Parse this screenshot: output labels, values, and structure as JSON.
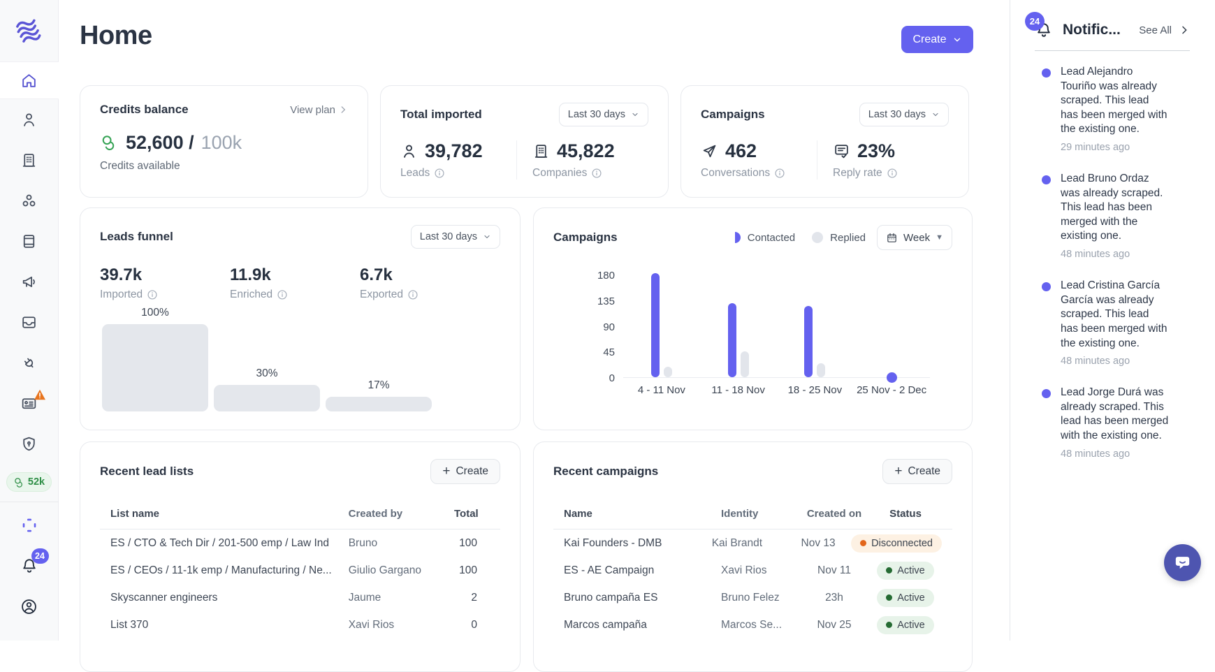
{
  "header": {
    "title": "Home",
    "create_label": "Create"
  },
  "sidebar": {
    "credits_pill": "52k",
    "bell_badge": "24"
  },
  "cards": {
    "credits": {
      "title": "Credits balance",
      "link": "View plan",
      "used": "52,600 /",
      "total": "100k",
      "caption": "Credits available"
    },
    "imported": {
      "title": "Total imported",
      "range": "Last 30 days",
      "stats": [
        {
          "value": "39,782",
          "label": "Leads"
        },
        {
          "value": "45,822",
          "label": "Companies"
        }
      ]
    },
    "campaigns": {
      "title": "Campaigns",
      "range": "Last 30 days",
      "stats": [
        {
          "value": "462",
          "label": "Conversations"
        },
        {
          "value": "23%",
          "label": "Reply rate"
        }
      ]
    }
  },
  "funnel": {
    "title": "Leads funnel",
    "range": "Last 30 days",
    "stats": [
      {
        "value": "39.7k",
        "label": "Imported"
      },
      {
        "value": "11.9k",
        "label": "Enriched"
      },
      {
        "value": "6.7k",
        "label": "Exported"
      }
    ],
    "stages": [
      {
        "label": "100%",
        "percent": 100
      },
      {
        "label": "30%",
        "percent": 30
      },
      {
        "label": "17%",
        "percent": 17
      }
    ]
  },
  "campaigns_chart": {
    "type": "bar",
    "title": "Campaigns",
    "legend": [
      {
        "name": "Contacted",
        "color": "#6461ef"
      },
      {
        "name": "Replied",
        "color": "#e2e5eb"
      }
    ],
    "range_selector": "Week",
    "categories": [
      "4 - 11 Nov",
      "11 - 18 Nov",
      "18 - 25 Nov",
      "25 Nov - 2 Dec"
    ],
    "series": [
      {
        "name": "Contacted",
        "values": [
          182,
          130,
          125,
          3
        ]
      },
      {
        "name": "Replied",
        "values": [
          18,
          45,
          25,
          0
        ]
      }
    ],
    "yticks": [
      0,
      45,
      90,
      135,
      180
    ],
    "ylim": [
      0,
      180
    ]
  },
  "lead_lists": {
    "title": "Recent lead lists",
    "create_label": "Create",
    "headers": {
      "name": "List name",
      "created_by": "Created by",
      "total": "Total"
    },
    "rows": [
      {
        "name": "ES / CTO & Tech Dir / 201-500 emp / Law Ind",
        "created_by": "Bruno",
        "total": "100"
      },
      {
        "name": "ES / CEOs / 11-1k emp / Manufacturing / Ne...",
        "created_by": "Giulio Gargano",
        "total": "100"
      },
      {
        "name": "Skyscanner engineers",
        "created_by": "Jaume",
        "total": "2"
      },
      {
        "name": "List 370",
        "created_by": "Xavi Rios",
        "total": "0"
      }
    ]
  },
  "recent_campaigns": {
    "title": "Recent campaigns",
    "create_label": "Create",
    "headers": {
      "name": "Name",
      "identity": "Identity",
      "created_on": "Created on",
      "status": "Status"
    },
    "rows": [
      {
        "name": "Kai Founders - DMB",
        "identity": "Kai Brandt",
        "created_on": "Nov 13",
        "status": "Disconnected"
      },
      {
        "name": "ES - AE Campaign",
        "identity": "Xavi Rios",
        "created_on": "Nov 11",
        "status": "Active"
      },
      {
        "name": "Bruno campaña ES",
        "identity": "Bruno Felez",
        "created_on": "23h",
        "status": "Active"
      },
      {
        "name": "Marcos campaña",
        "identity": "Marcos Se...",
        "created_on": "Nov 25",
        "status": "Active"
      }
    ]
  },
  "notifications": {
    "badge": "24",
    "title": "Notific...",
    "see_all": "See All",
    "items": [
      {
        "text": "Lead Alejandro Touriño was already scraped. This lead has been merged with the existing one.",
        "time": "29 minutes ago"
      },
      {
        "text": "Lead Bruno Ordaz was already scraped. This lead has been merged with the existing one.",
        "time": "48 minutes ago"
      },
      {
        "text": "Lead Cristina García García was already scraped. This lead has been merged with the existing one.",
        "time": "48 minutes ago"
      },
      {
        "text": "Lead Jorge Durá was already scraped. This lead has been merged with the existing one.",
        "time": "48 minutes ago"
      }
    ]
  },
  "colors": {
    "accent": "#6461ef",
    "green": "#2f8f47",
    "warning": "#e8751f",
    "status_active_bg": "#e7f3e9",
    "status_disconnected_bg": "#fdf1e3"
  }
}
